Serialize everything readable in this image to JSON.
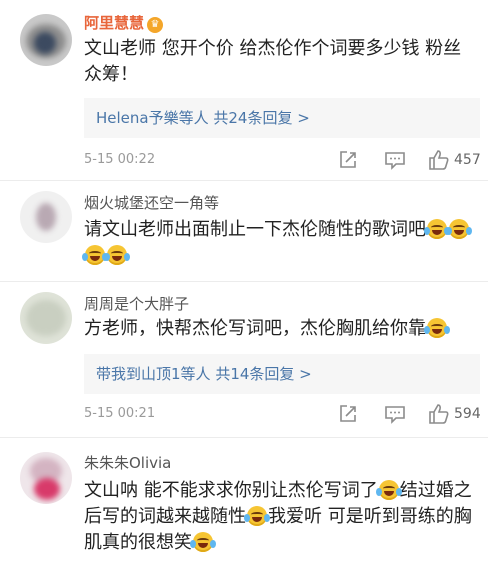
{
  "comments": [
    {
      "name": "阿里慧慧",
      "vip_icon": "vip-crown-icon",
      "text": "文山老师 您开个价 给杰伦作个词要多少钱 粉丝众筹！",
      "replies_user": "Helena予樂",
      "replies_text": "等人 共24条回复 >",
      "time": "5-15 00:22",
      "likes": "457"
    },
    {
      "name": "烟火城堡还空一角等",
      "text_before": "请文山老师出面制止一下杰伦随性的歌词吧",
      "emoji": "laugh-cry-emoji"
    },
    {
      "name": "周周是个大胖子",
      "text": "方老师，快帮杰伦写词吧，杰伦胸肌给你靠",
      "replies_user": "带我到山顶1",
      "replies_text": "等人 共14条回复 >",
      "time": "5-15 00:21",
      "likes": "594"
    },
    {
      "name": "朱朱朱Olivia",
      "text_part1": "文山呐 能不能求求你别让杰伦写词了",
      "text_part2": "结过婚之后写的词越来越随性",
      "text_part3": "我爱听 可是听到哥练的胸肌真的很想笑"
    }
  ],
  "icons": {
    "share": "share-icon",
    "comment": "comment-icon",
    "like": "thumbs-up-icon"
  },
  "colors": {
    "vip_name": "#e8663b",
    "link": "#4a76a8",
    "meta": "#9a9a9a"
  }
}
